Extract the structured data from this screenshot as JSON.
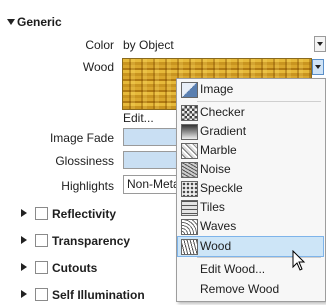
{
  "generic": {
    "title": "Generic",
    "color_label": "Color",
    "color_value": "by Object",
    "wood_label": "Wood",
    "edit_button": "Edit...",
    "image_fade_label": "Image Fade",
    "glossiness_label": "Glossiness",
    "highlights_label": "Highlights",
    "highlights_value": "Non-Meta"
  },
  "sections": [
    {
      "label": "Reflectivity"
    },
    {
      "label": "Transparency"
    },
    {
      "label": "Cutouts"
    },
    {
      "label": "Self Illumination"
    }
  ],
  "menu": {
    "items": [
      {
        "label": "Image",
        "icon": "image-icon"
      },
      {
        "label": "Checker",
        "icon": "checker-icon"
      },
      {
        "label": "Gradient",
        "icon": "gradient-icon"
      },
      {
        "label": "Marble",
        "icon": "marble-icon"
      },
      {
        "label": "Noise",
        "icon": "noise-icon"
      },
      {
        "label": "Speckle",
        "icon": "speckle-icon"
      },
      {
        "label": "Tiles",
        "icon": "tiles-icon"
      },
      {
        "label": "Waves",
        "icon": "waves-icon"
      },
      {
        "label": "Wood",
        "icon": "wood-icon",
        "selected": true
      }
    ],
    "edit_wood": "Edit Wood...",
    "remove_wood": "Remove Wood"
  }
}
